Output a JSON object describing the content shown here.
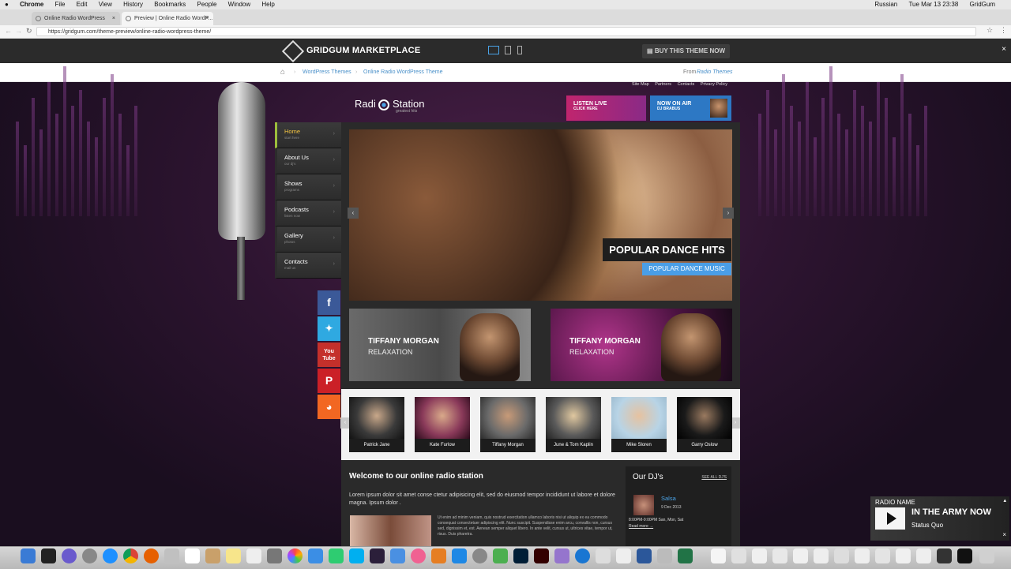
{
  "menubar": {
    "app": "Chrome",
    "items": [
      "File",
      "Edit",
      "View",
      "History",
      "Bookmarks",
      "People",
      "Window",
      "Help"
    ],
    "lang": "Russian",
    "datetime": "Tue Mar 13  23:38",
    "user": "GridGum"
  },
  "tabs": [
    {
      "label": "Online Radio WordPress Theme"
    },
    {
      "label": "Preview | Online Radio WordP..."
    }
  ],
  "address": {
    "url": "https://gridgum.com/theme-preview/online-radio-wordpress-theme/"
  },
  "gridgum": {
    "brand": "GRIDGUM MARKETPLACE",
    "buy": "BUY THIS THEME NOW",
    "close": "×"
  },
  "breadcrumb": {
    "items": [
      "WordPress Themes",
      "Online Radio WordPress Theme"
    ],
    "from_label": "From",
    "from_link": "Radio Themes"
  },
  "site": {
    "logo": "Radi",
    "logo2": "Station",
    "tagline": "greatest hits",
    "topnav": [
      "Site Map",
      "Partners",
      "Contacts",
      "Privacy Policy"
    ],
    "listen": {
      "t1": "LISTEN LIVE",
      "t2": "CLICK HERE"
    },
    "nowair": {
      "t1": "NOW ON AIR",
      "t2": "DJ BRABUS"
    },
    "menu": [
      {
        "label": "Home",
        "sub": "start here"
      },
      {
        "label": "About Us",
        "sub": "our dj's"
      },
      {
        "label": "Shows",
        "sub": "programs"
      },
      {
        "label": "Podcasts",
        "sub": "listen now"
      },
      {
        "label": "Gallery",
        "sub": "photos"
      },
      {
        "label": "Contacts",
        "sub": "mail us"
      }
    ],
    "social": [
      {
        "icon": "facebook-icon",
        "glyph": "f",
        "color": "#3b5998"
      },
      {
        "icon": "twitter-icon",
        "glyph": "t",
        "color": "#2fa9e1"
      },
      {
        "icon": "youtube-icon",
        "glyph": "You Tube",
        "color": "#c4302b"
      },
      {
        "icon": "pinterest-icon",
        "glyph": "P",
        "color": "#cb2027"
      },
      {
        "icon": "soundcloud-icon",
        "glyph": "◉",
        "color": "#f26722"
      }
    ],
    "slide": {
      "title": "POPULAR DANCE HITS",
      "subtitle": "POPULAR DANCE MUSIC"
    },
    "banners": [
      {
        "name": "TIFFANY MORGAN",
        "genre": "RELAXATION"
      },
      {
        "name": "TIFFANY MORGAN",
        "genre": "RELAXATION"
      }
    ],
    "djs": [
      "Patrick Jane",
      "Kate Furlow",
      "Tiffany Morgan",
      "June & Tom Kaplin",
      "Mike Sloren",
      "Garry Oslow"
    ],
    "welcome": {
      "title": "Welcome to our online radio station",
      "lead": "Lorem ipsum dolor sit amet conse ctetur adipisicing elit, sed do eiusmod tempor incididunt ut labore et dolore magna. Ipsum dolor .",
      "body": "Ut enim ad minim veniam, quis nostrud exercitation ullamco laboris nisi ut aliquip ex ea commodo consequat consectetuer adipiscing elit. Nunc suscipit. Suspendisse enim arcu, convallis non, cursus sed, dignissim et, est. Aenean semper aliquet libero. In ante velit, cursus ut, ultrices vitae, tempor ut, risus. Duis pharetra."
    },
    "ourdjs": {
      "title": "Our DJ's",
      "see_all": "SEE ALL DJ'S",
      "item_name": "Salsa",
      "item_date": "9 Dec 2013",
      "item_time": "8:00PM-9:00PM San, Mon, Sat",
      "read_more": "Read more →"
    }
  },
  "player": {
    "label": "RADIO NAME",
    "song": "IN THE ARMY NOW",
    "artist": "Status Quo"
  },
  "colors": {
    "accent_blue": "#4a9ee6",
    "accent_green": "#9cbd3c",
    "home_active": "#f4c542"
  }
}
